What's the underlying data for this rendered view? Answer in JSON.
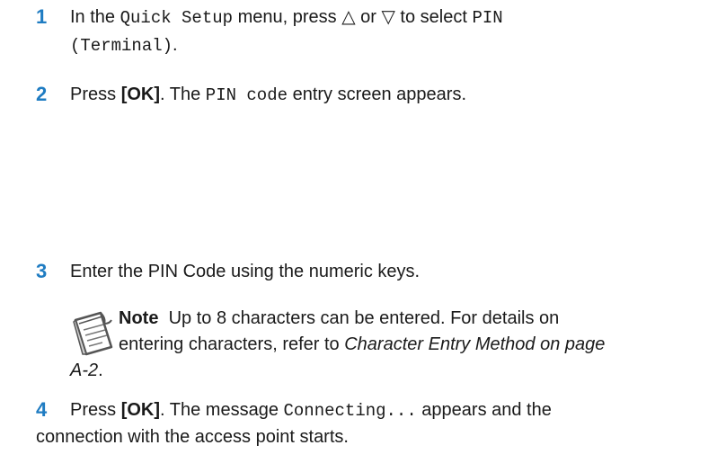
{
  "steps": [
    {
      "number": "1",
      "text_a": "In the ",
      "code_a": "Quick Setup",
      "text_b": " menu, press △ or ▽ to select ",
      "code_b": "PIN",
      "code_c": "(Terminal)",
      "text_c": "."
    },
    {
      "number": "2",
      "text_a": "Press ",
      "bold_a": "[OK]",
      "text_b": ". The ",
      "code_a": "PIN code",
      "text_c": " entry screen appears."
    },
    {
      "number": "3",
      "text_a": "Enter the PIN Code using the numeric keys."
    },
    {
      "number": "4",
      "text_a": "Press ",
      "bold_a": "[OK]",
      "text_b": ". The message ",
      "code_a": "Connecting...",
      "text_c": " appears and the",
      "text_d": "connection with the access point starts."
    }
  ],
  "note": {
    "label": "Note",
    "line1": "Up to 8 characters can be entered. For details on",
    "line2a": "entering characters, refer to ",
    "line2b": "Character Entry Method on page",
    "line3a": "A-2",
    "line3b": "."
  }
}
